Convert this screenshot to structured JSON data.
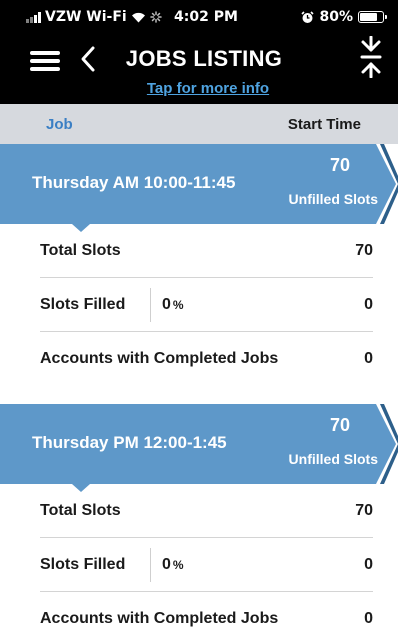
{
  "status_bar": {
    "carrier": "VZW Wi-Fi",
    "time": "4:02 PM",
    "battery": "80%",
    "battery_level": 0.8
  },
  "header": {
    "title": "JOBS LISTING",
    "link": "Tap for more info"
  },
  "columns": {
    "job": "Job",
    "start_time": "Start Time"
  },
  "colors": {
    "banner": "#5e98c9",
    "link": "#4fa3e0",
    "column_bar": "#d6d9de"
  },
  "jobs": [
    {
      "name": "Thursday AM 10:00-11:45",
      "unfilled_count": "70",
      "unfilled_label": "Unfilled Slots",
      "total_slots_label": "Total Slots",
      "total_slots": "70",
      "slots_filled_label": "Slots Filled",
      "slots_filled_pct": "0",
      "pct_sign": "%",
      "slots_filled": "0",
      "completed_label": "Accounts with Completed Jobs",
      "completed": "0"
    },
    {
      "name": "Thursday PM 12:00-1:45",
      "unfilled_count": "70",
      "unfilled_label": "Unfilled Slots",
      "total_slots_label": "Total Slots",
      "total_slots": "70",
      "slots_filled_label": "Slots Filled",
      "slots_filled_pct": "0",
      "pct_sign": "%",
      "slots_filled": "0",
      "completed_label": "Accounts with Completed Jobs",
      "completed": "0"
    }
  ]
}
